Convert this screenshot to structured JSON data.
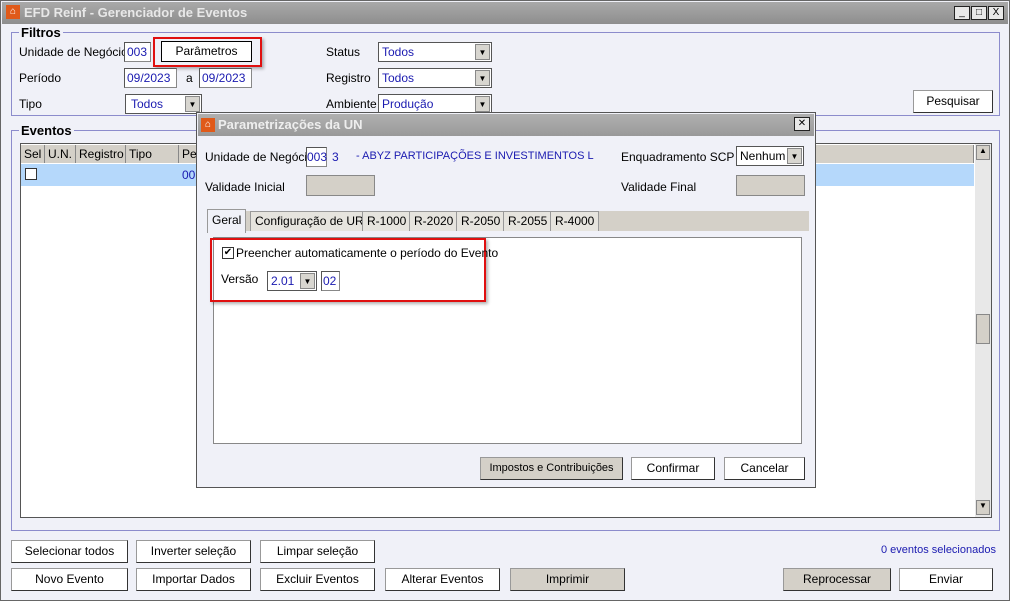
{
  "window": {
    "title": "EFD Reinf - Gerenciador de Eventos",
    "controls": [
      "_",
      "□",
      "X"
    ]
  },
  "filters": {
    "legend": "Filtros",
    "unidade_label": "Unidade de Negócio",
    "unidade_value": "003",
    "parametros_button": "Parâmetros",
    "periodo_label": "Período",
    "periodo_from": "09/2023",
    "periodo_sep": "a",
    "periodo_to": "09/2023",
    "tipo_label": "Tipo",
    "tipo_value": "Todos",
    "status_label": "Status",
    "status_value": "Todos",
    "registro_label": "Registro",
    "registro_value": "Todos",
    "ambiente_label": "Ambiente",
    "ambiente_value": "Produção",
    "pesquisar_button": "Pesquisar"
  },
  "events": {
    "legend": "Eventos",
    "columns": [
      "Sel",
      "U.N.",
      "Registro",
      "Tipo",
      "Pe"
    ],
    "row": {
      "period_partial": "00"
    }
  },
  "dialog": {
    "title": "Parametrizações da UN",
    "unidade_label": "Unidade de Negócio",
    "unidade_value": "003",
    "unidade_code": "3",
    "company": "- ABYZ PARTICIPAÇÕES E INVESTIMENTOS L",
    "enquadramento_label": "Enquadramento SCP",
    "enquadramento_value": "Nenhum",
    "validade_inicial_label": "Validade Inicial",
    "validade_final_label": "Validade Final",
    "tabs": [
      "Geral",
      "Configuração de URL",
      "R-1000",
      "R-2020",
      "R-2050",
      "R-2055",
      "R-4000"
    ],
    "active_tab": "Geral",
    "preencher_label": "Preencher automaticamente o período do Evento",
    "preencher_checked": true,
    "versao_label": "Versão",
    "versao_value": "2.01",
    "versao_sub": "02",
    "buttons": {
      "impostos": "Impostos e Contribuições",
      "confirmar": "Confirmar",
      "cancelar": "Cancelar"
    }
  },
  "footer": {
    "selecionar_todos": "Selecionar todos",
    "inverter": "Inverter seleção",
    "limpar": "Limpar seleção",
    "selected_count": "0 eventos selecionados",
    "novo": "Novo Evento",
    "importar": "Importar Dados",
    "excluir": "Excluir Eventos",
    "alterar": "Alterar Eventos",
    "imprimir": "Imprimir",
    "reprocessar": "Reprocessar",
    "enviar": "Enviar"
  },
  "colors": {
    "highlight": "#e01010",
    "row_selected": "#b5d8fb",
    "value_text": "#1a1ab0"
  }
}
